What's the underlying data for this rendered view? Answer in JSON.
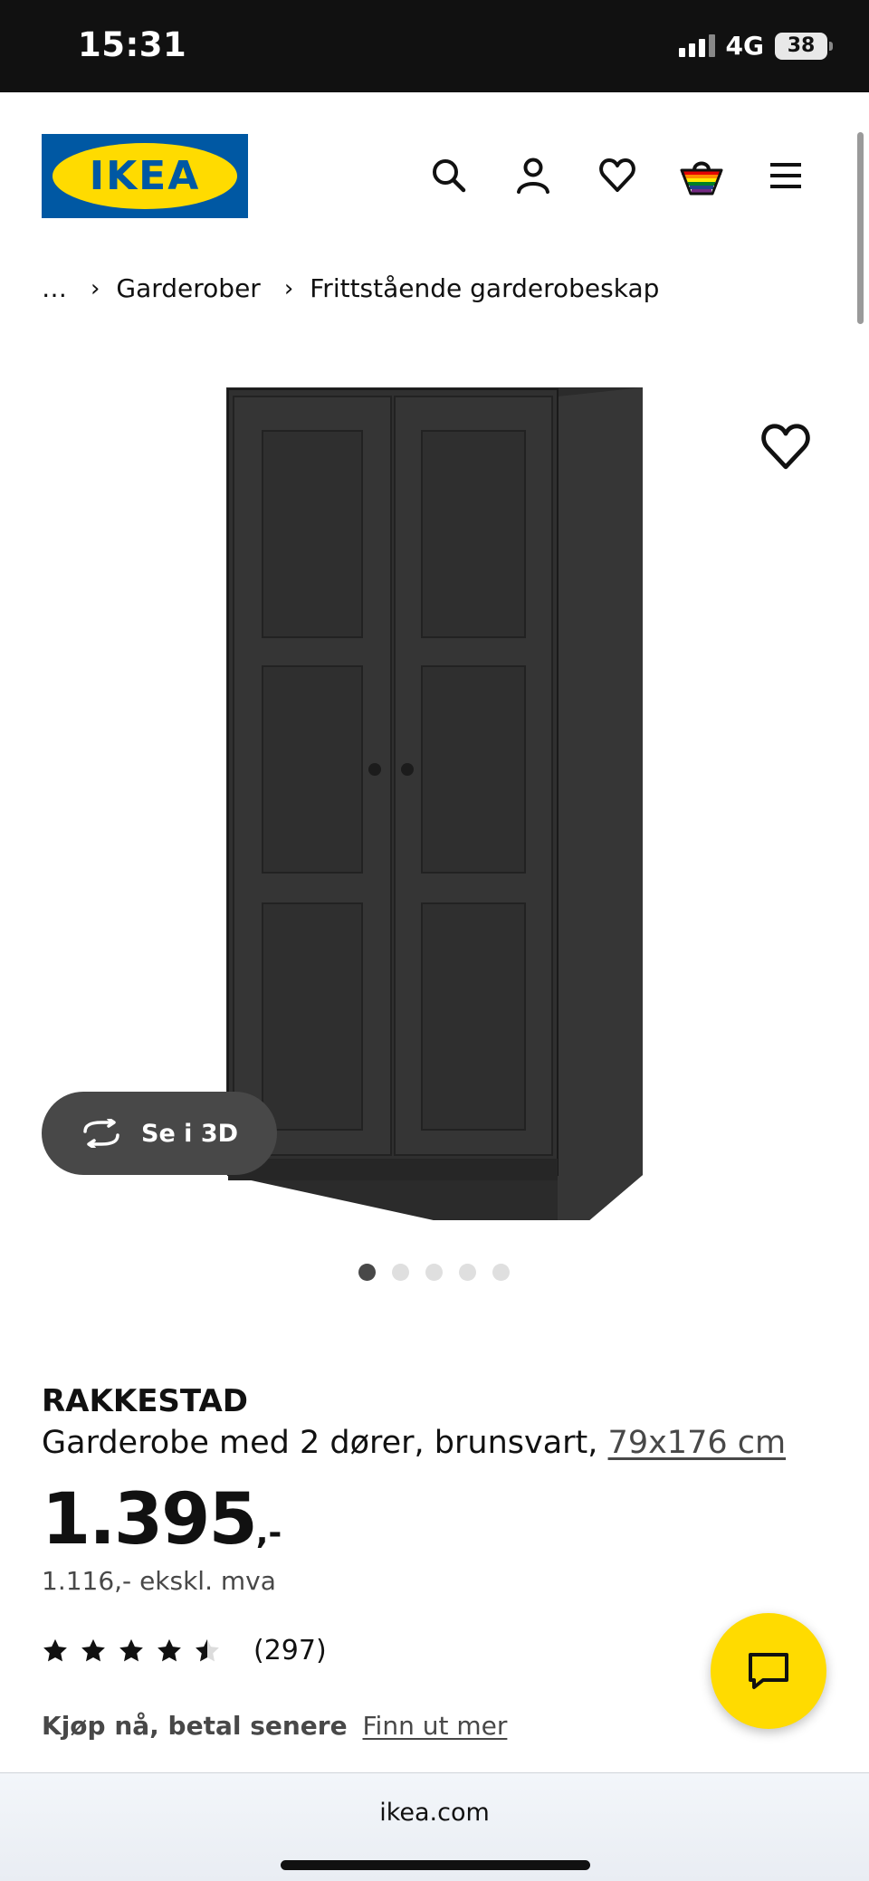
{
  "status_bar": {
    "time": "15:31",
    "network": "4G",
    "battery": "38"
  },
  "header": {
    "logo_text": "IKEA",
    "icons": [
      "search-icon",
      "account-icon",
      "wishlist-icon",
      "cart-icon",
      "menu-icon"
    ]
  },
  "breadcrumb": {
    "ellipsis": "…",
    "items": [
      "Garderober",
      "Frittstående garderobeskap"
    ]
  },
  "gallery": {
    "view3d_label": "Se i 3D",
    "image_count": 5,
    "active_index": 0
  },
  "product": {
    "name": "RAKKESTAD",
    "description": "Garderobe med 2 dører, brunsvart,",
    "dimensions": "79x176 cm",
    "price": "1.395",
    "price_suffix": ",-",
    "price_ex_vat": "1.116,- ekskl. mva",
    "rating_value": 4.5,
    "rating_max": 5,
    "review_count": "(297)",
    "bnpl_label": "Kjøp nå, betal senere",
    "bnpl_link": "Finn ut mer"
  },
  "browser": {
    "url": "ikea.com"
  },
  "colors": {
    "brand_blue": "#0058a3",
    "brand_yellow": "#ffdb00",
    "dark_text": "#111111",
    "muted_text": "#484848"
  }
}
